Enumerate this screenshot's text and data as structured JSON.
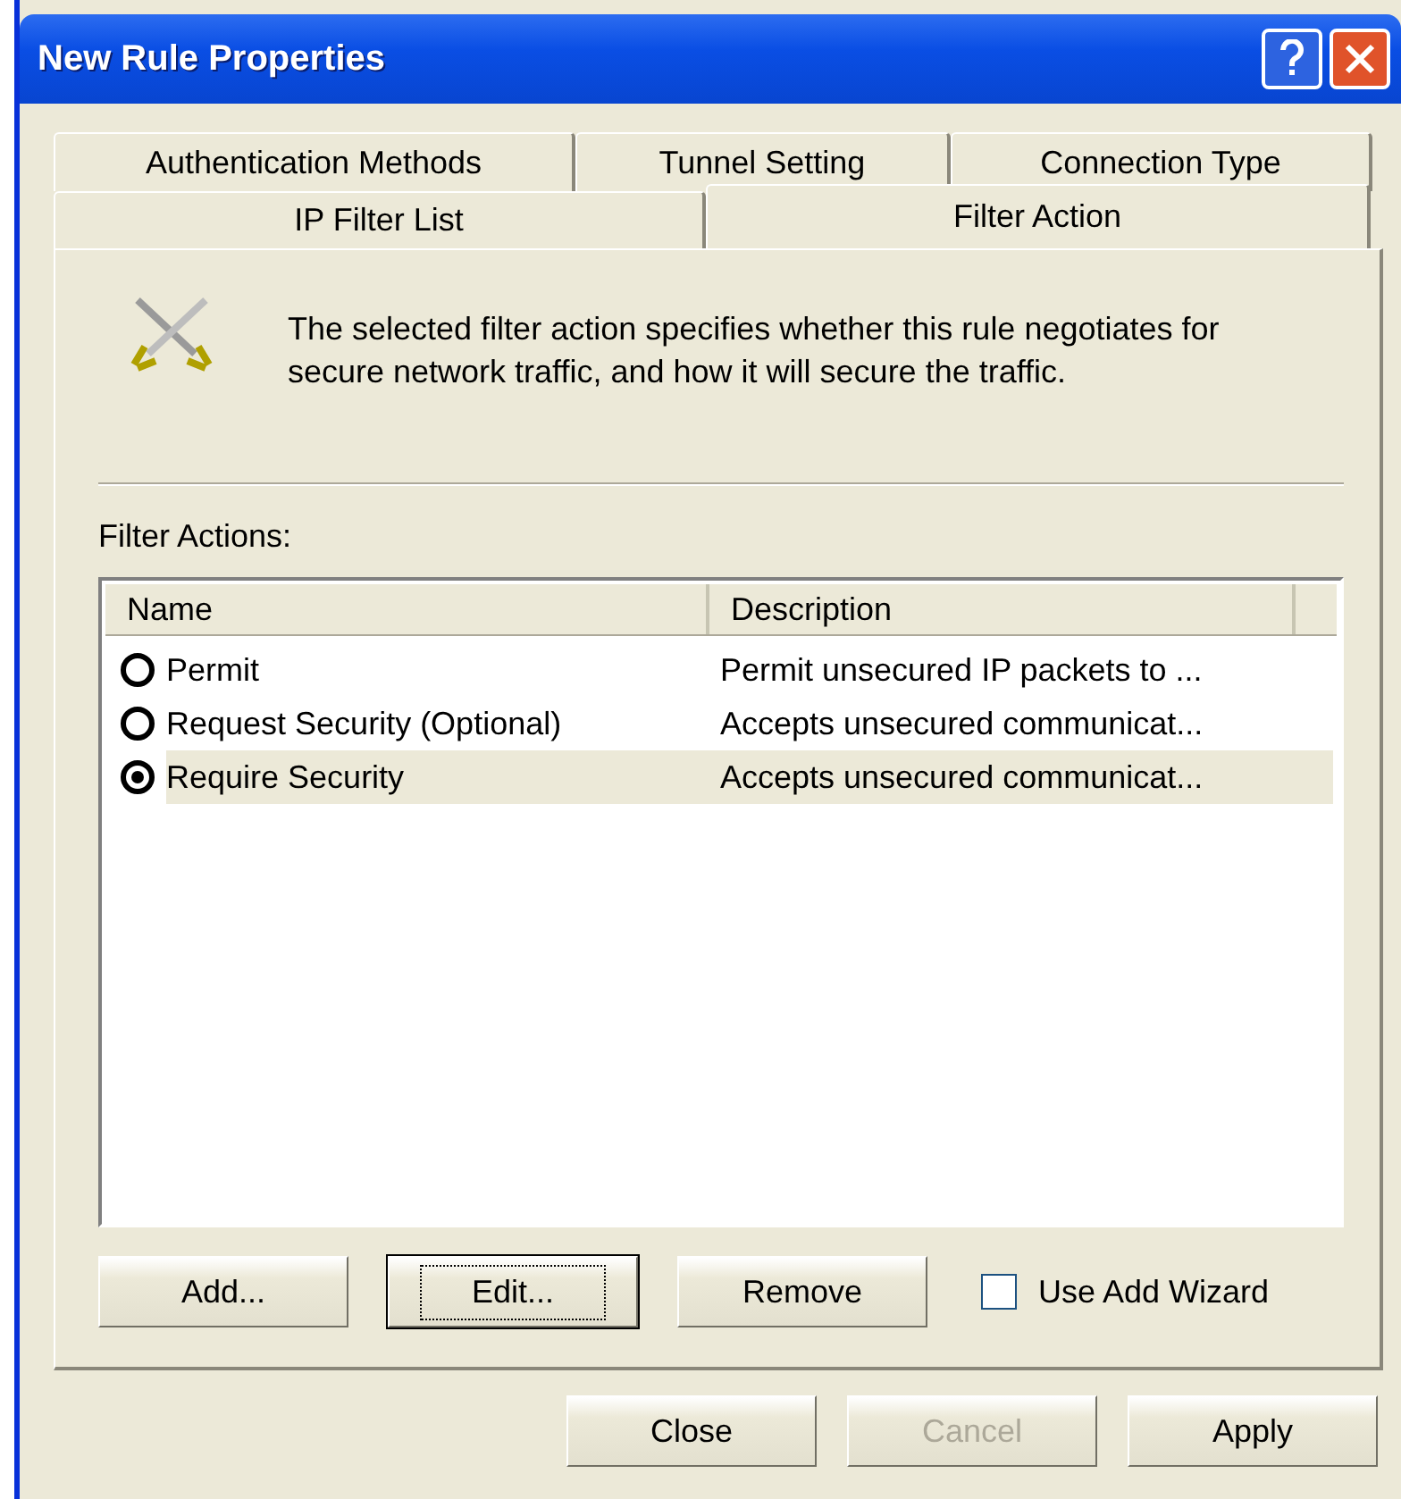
{
  "window": {
    "title": "New Rule Properties"
  },
  "tab_rows": [
    [
      {
        "label": "Authentication Methods",
        "selected": false
      },
      {
        "label": "Tunnel Setting",
        "selected": false
      },
      {
        "label": "Connection Type",
        "selected": false
      }
    ],
    [
      {
        "label": "IP Filter List",
        "selected": false
      },
      {
        "label": "Filter Action",
        "selected": true
      }
    ]
  ],
  "description": "The selected filter action specifies whether this rule negotiates for secure network traffic, and how it will secure the traffic.",
  "list": {
    "label": "Filter Actions:",
    "columns": [
      "Name",
      "Description"
    ],
    "rows": [
      {
        "name": "Permit",
        "description": "Permit unsecured IP packets to ...",
        "checked": false,
        "selected": false
      },
      {
        "name": "Request Security (Optional)",
        "description": "Accepts unsecured communicat...",
        "checked": false,
        "selected": false
      },
      {
        "name": "Require Security",
        "description": "Accepts unsecured communicat...",
        "checked": true,
        "selected": true
      }
    ]
  },
  "list_buttons": [
    {
      "label": "Add...",
      "focused": false
    },
    {
      "label": "Edit...",
      "focused": true
    },
    {
      "label": "Remove",
      "focused": false
    }
  ],
  "wizard_checkbox": {
    "label": "Use Add Wizard",
    "checked": false
  },
  "footer_buttons": [
    {
      "label": "Close",
      "disabled": false
    },
    {
      "label": "Cancel",
      "disabled": true
    },
    {
      "label": "Apply",
      "disabled": false
    }
  ]
}
